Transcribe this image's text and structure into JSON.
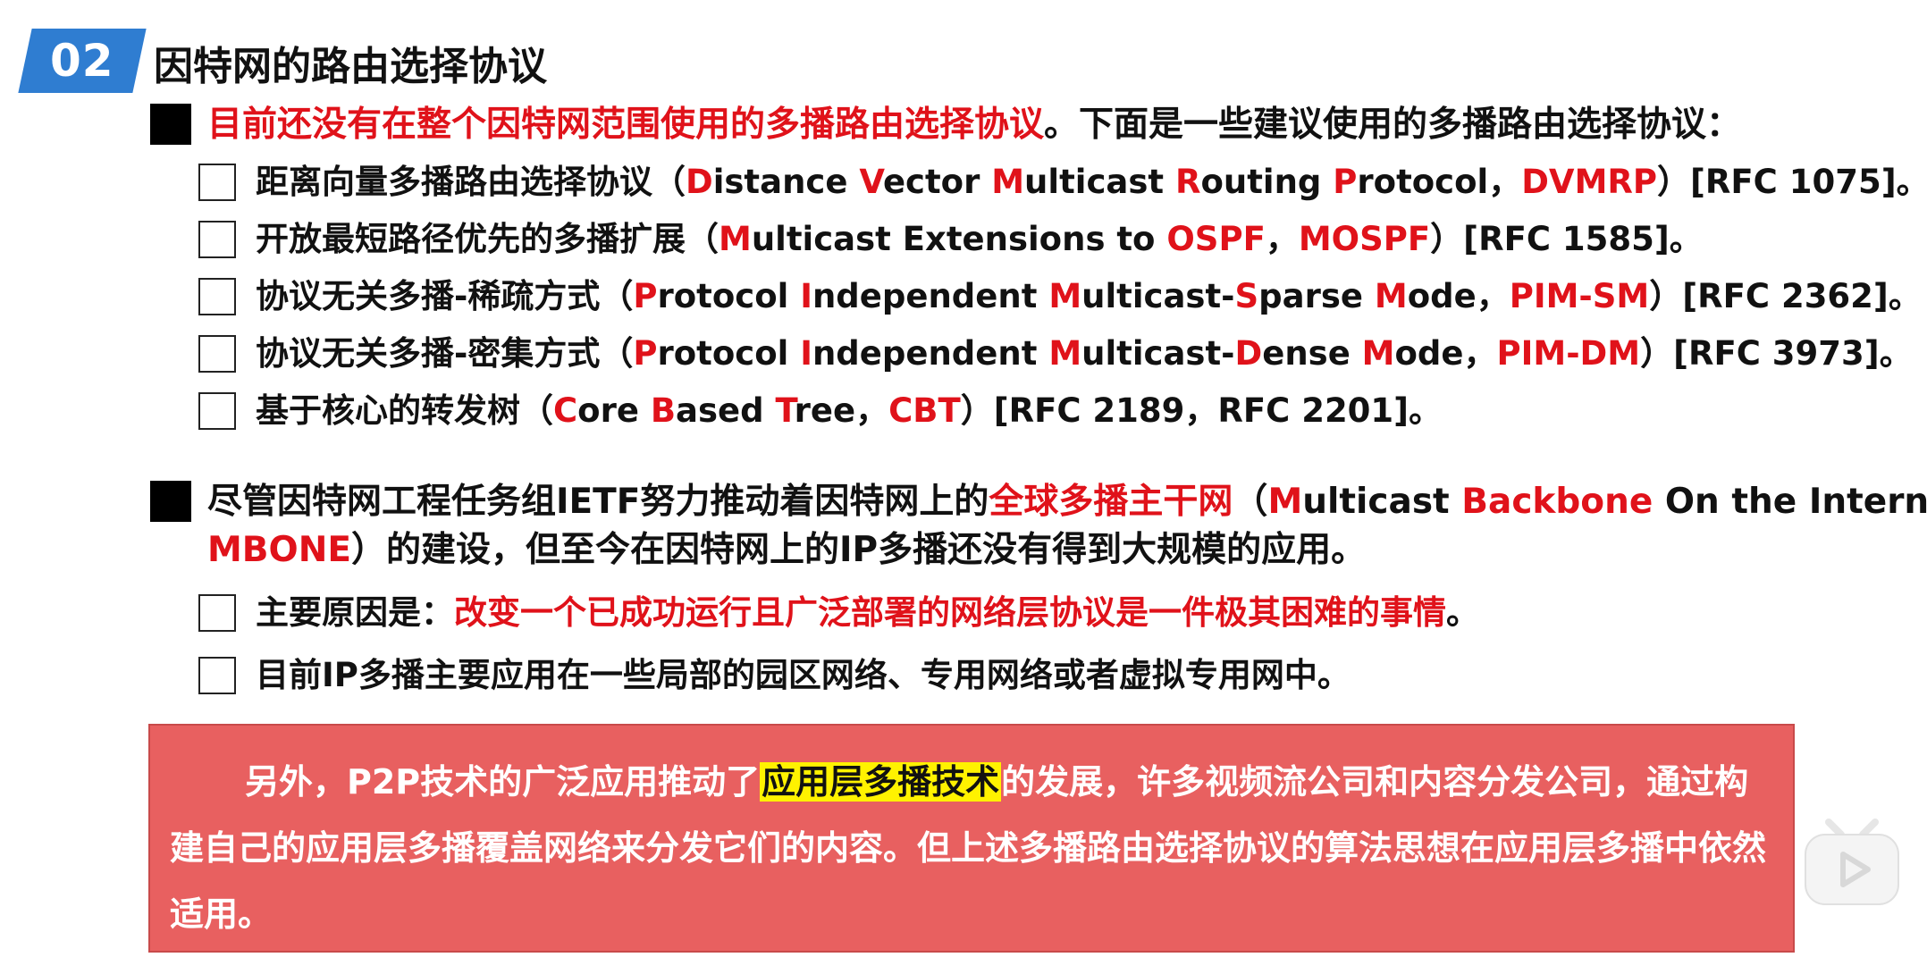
{
  "header": {
    "badge": "02",
    "title": "因特网的路由选择协议"
  },
  "bullet1": {
    "red_text": "目前还没有在整个因特网范围使用的多播路由选择协议",
    "black_text": "。下面是一些建议使用的多播路由选择协议："
  },
  "protocols": [
    {
      "name": "距离向量多播路由选择协议（",
      "parts": [
        "D",
        "istance ",
        "V",
        "ector ",
        "M",
        "ulticast ",
        "R",
        "outing ",
        "P",
        "rotocol，"
      ],
      "abbr": "DVMRP",
      "ref": "）[RFC 1075]。"
    },
    {
      "name": "开放最短路径优先的多播扩展（",
      "parts": [
        "M",
        "ulticast Extensions to ",
        "OSPF",
        "，"
      ],
      "abbr": "MOSPF",
      "ref": "）[RFC 1585]。"
    },
    {
      "name": "协议无关多播-稀疏方式（",
      "parts": [
        "P",
        "rotocol ",
        "I",
        "ndependent ",
        "M",
        "ulticast-",
        "S",
        "parse ",
        "M",
        "ode，"
      ],
      "abbr": "PIM-SM",
      "ref": "）[RFC 2362]。"
    },
    {
      "name": "协议无关多播-密集方式（",
      "parts": [
        "P",
        "rotocol ",
        "I",
        "ndependent ",
        "M",
        "ulticast-",
        "D",
        "ense ",
        "M",
        "ode，"
      ],
      "abbr": "PIM-DM",
      "ref": "）[RFC 3973]。"
    },
    {
      "name": "基于核心的转发树（",
      "parts": [
        "C",
        "ore ",
        "B",
        "ased ",
        "T",
        "ree，"
      ],
      "abbr": "CBT",
      "ref": "）[RFC 2189，RFC 2201]。"
    }
  ],
  "bullet2": {
    "text1": "尽管因特网工程任务组IETF努力推动着因特网上的",
    "red1": "全球多播主干网",
    "text2": "（",
    "m": "M",
    "ulticast": "ulticast ",
    "b": "B",
    "backbone": "ackbone",
    "rest": " On the Internet，",
    "mbone": "MBONE",
    "text3": "）的建设，但至今在因特网上的IP多播还没有得到大规模的应用。"
  },
  "reasons": {
    "r1_label": "主要原因是：",
    "r1_red": "改变一个已成功运行且广泛部署的网络层协议是一件极其困难的事情",
    "r1_end": "。",
    "r2": "目前IP多播主要应用在一些局部的园区网络、专用网络或者虚拟专用网中。"
  },
  "note": {
    "part1": "另外，P2P技术的广泛应用推动了",
    "highlight": "应用层多播技术",
    "part2": "的发展，许多视频流公司和内容分发公司，通过构建自己的应用层多播覆盖网络来分发它们的内容。但上述多播路由选择协议的算法思想在应用层多播中依然适用。"
  },
  "colors": {
    "accent_red": "#e0121a",
    "badge_blue": "#2f7dd1",
    "note_bg": "#e86060",
    "highlight": "#fff200"
  },
  "icons": {
    "player": "play-icon"
  }
}
